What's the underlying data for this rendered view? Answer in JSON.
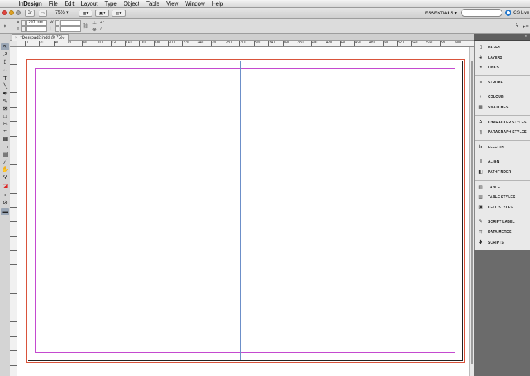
{
  "menubar": {
    "apple": "",
    "items": [
      "InDesign",
      "File",
      "Edit",
      "Layout",
      "Type",
      "Object",
      "Table",
      "View",
      "Window",
      "Help"
    ]
  },
  "appbar": {
    "zoom": "75%",
    "workspace": "ESSENTIALS ▾",
    "search_placeholder": "",
    "cslive": "CS Live"
  },
  "controlbar": {
    "x_label": "X",
    "x_value": "297 mm",
    "y_label": "Y",
    "w_label": "W",
    "h_label": "H"
  },
  "document": {
    "tab_title": "*Deskpad2.indd @ 75%"
  },
  "ruler": {
    "labels": [
      "0",
      "20",
      "40",
      "60",
      "80",
      "100",
      "120",
      "140",
      "160",
      "180",
      "200",
      "220",
      "240",
      "260",
      "280",
      "300",
      "320",
      "340",
      "360",
      "380",
      "400",
      "420",
      "440",
      "460",
      "480",
      "500",
      "520",
      "540",
      "560",
      "580",
      "600"
    ]
  },
  "dock": {
    "panels": [
      {
        "label": "PAGES",
        "icon": "pages-icon"
      },
      {
        "label": "LAYERS",
        "icon": "layers-icon"
      },
      {
        "label": "LINKS",
        "icon": "links-icon"
      },
      {
        "label": "STROKE",
        "icon": "stroke-icon"
      },
      {
        "label": "COLOUR",
        "icon": "colour-icon"
      },
      {
        "label": "SWATCHES",
        "icon": "swatches-icon"
      },
      {
        "label": "CHARACTER STYLES",
        "icon": "character-styles-icon"
      },
      {
        "label": "PARAGRAPH STYLES",
        "icon": "paragraph-styles-icon"
      },
      {
        "label": "EFFECTS",
        "icon": "effects-icon"
      },
      {
        "label": "ALIGN",
        "icon": "align-icon"
      },
      {
        "label": "PATHFINDER",
        "icon": "pathfinder-icon"
      },
      {
        "label": "TABLE",
        "icon": "table-icon"
      },
      {
        "label": "TABLE STYLES",
        "icon": "table-styles-icon"
      },
      {
        "label": "CELL STYLES",
        "icon": "cell-styles-icon"
      },
      {
        "label": "SCRIPT LABEL",
        "icon": "script-label-icon"
      },
      {
        "label": "DATA MERGE",
        "icon": "data-merge-icon"
      },
      {
        "label": "SCRIPTS",
        "icon": "scripts-icon"
      }
    ]
  }
}
